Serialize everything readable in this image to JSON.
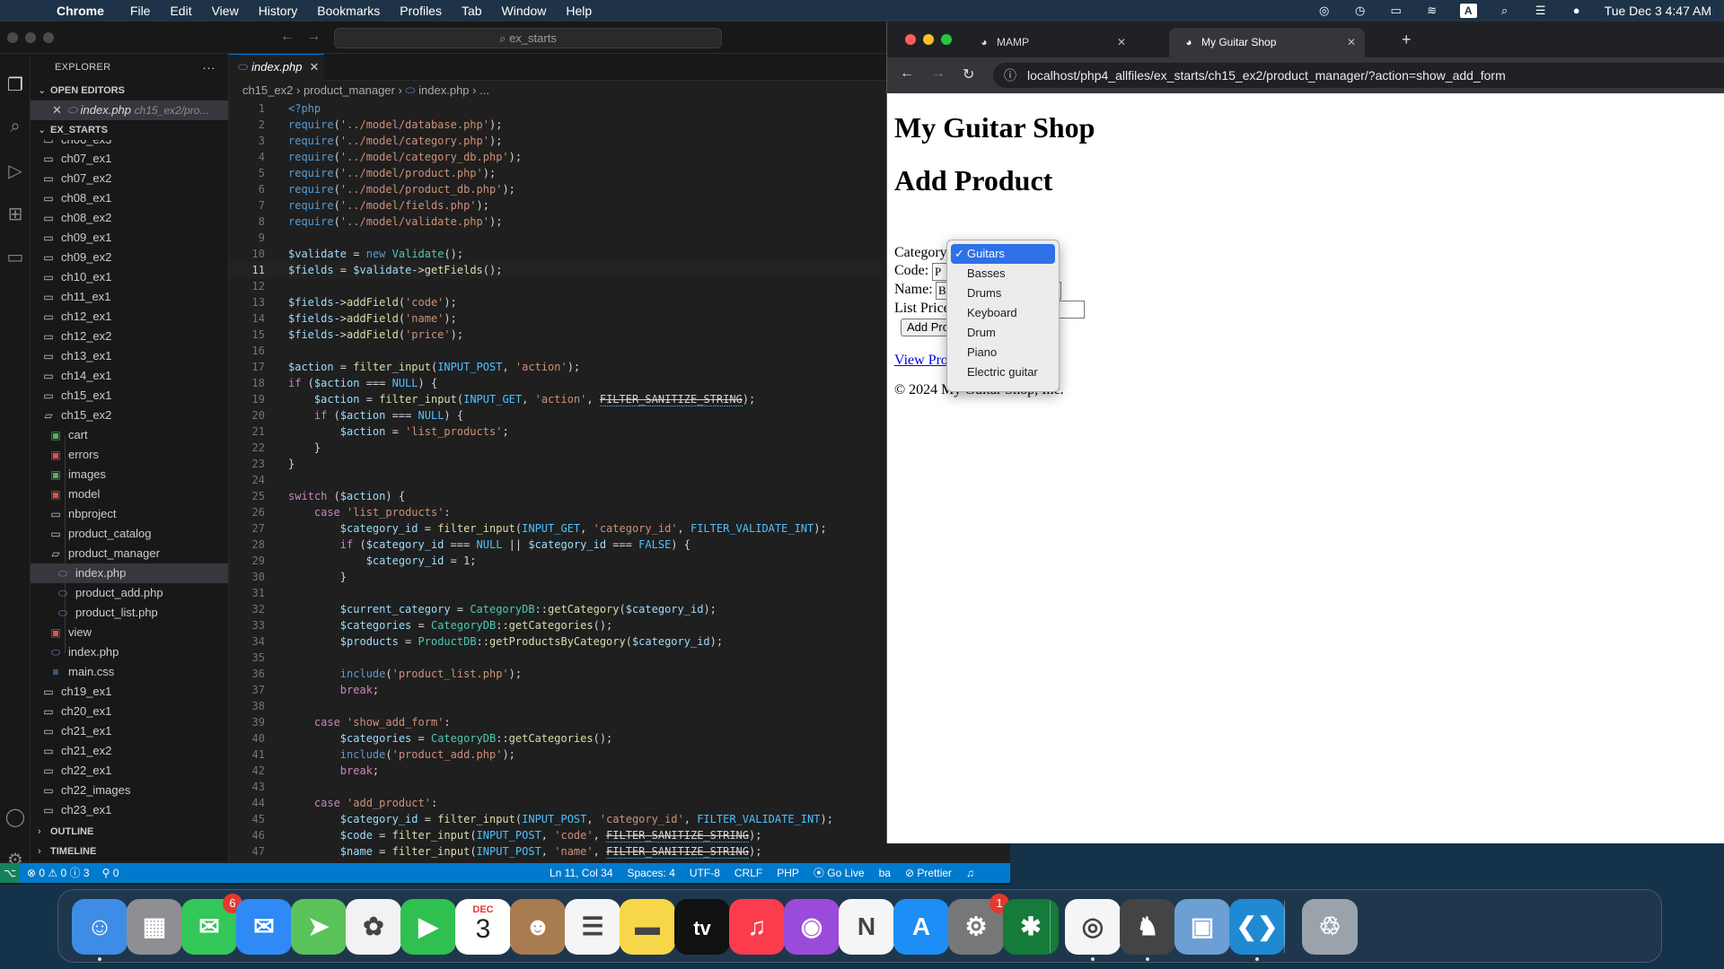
{
  "menubar": {
    "items": [
      "Chrome",
      "File",
      "Edit",
      "View",
      "History",
      "Bookmarks",
      "Profiles",
      "Tab",
      "Window",
      "Help"
    ],
    "input_indicator": "A",
    "datetime": "Tue Dec 3  4:47 AM"
  },
  "vscode": {
    "search_text": "ex_starts",
    "explorer_title": "EXPLORER",
    "open_editors_label": "OPEN EDITORS",
    "open_editor_file": "index.php",
    "open_editor_path": "ch15_ex2/pro...",
    "workspace_label": "EX_STARTS",
    "tree": [
      {
        "name": "ch06_ex3",
        "type": "folder"
      },
      {
        "name": "ch07_ex1",
        "type": "folder"
      },
      {
        "name": "ch07_ex2",
        "type": "folder"
      },
      {
        "name": "ch08_ex1",
        "type": "folder"
      },
      {
        "name": "ch08_ex2",
        "type": "folder"
      },
      {
        "name": "ch09_ex1",
        "type": "folder"
      },
      {
        "name": "ch09_ex2",
        "type": "folder"
      },
      {
        "name": "ch10_ex1",
        "type": "folder"
      },
      {
        "name": "ch11_ex1",
        "type": "folder"
      },
      {
        "name": "ch12_ex1",
        "type": "folder"
      },
      {
        "name": "ch12_ex2",
        "type": "folder"
      },
      {
        "name": "ch13_ex1",
        "type": "folder"
      },
      {
        "name": "ch14_ex1",
        "type": "folder"
      },
      {
        "name": "ch15_ex1",
        "type": "folder"
      },
      {
        "name": "ch15_ex2",
        "type": "folder-open"
      },
      {
        "name": "cart",
        "type": "folder-green",
        "depth": 1
      },
      {
        "name": "errors",
        "type": "folder-red",
        "depth": 1
      },
      {
        "name": "images",
        "type": "folder-green",
        "depth": 1
      },
      {
        "name": "model",
        "type": "folder-red",
        "depth": 1
      },
      {
        "name": "nbproject",
        "type": "folder",
        "depth": 1
      },
      {
        "name": "product_catalog",
        "type": "folder",
        "depth": 1
      },
      {
        "name": "product_manager",
        "type": "folder-open",
        "depth": 1
      },
      {
        "name": "index.php",
        "type": "php",
        "depth": 2,
        "selected": true
      },
      {
        "name": "product_add.php",
        "type": "php",
        "depth": 2
      },
      {
        "name": "product_list.php",
        "type": "php",
        "depth": 2
      },
      {
        "name": "view",
        "type": "folder-red",
        "depth": 1
      },
      {
        "name": "index.php",
        "type": "php",
        "depth": 1
      },
      {
        "name": "main.css",
        "type": "css",
        "depth": 1
      },
      {
        "name": "ch19_ex1",
        "type": "folder"
      },
      {
        "name": "ch20_ex1",
        "type": "folder"
      },
      {
        "name": "ch21_ex1",
        "type": "folder"
      },
      {
        "name": "ch21_ex2",
        "type": "folder"
      },
      {
        "name": "ch22_ex1",
        "type": "folder"
      },
      {
        "name": "ch22_images",
        "type": "folder"
      },
      {
        "name": "ch23_ex1",
        "type": "folder"
      }
    ],
    "outline_label": "OUTLINE",
    "timeline_label": "TIMELINE",
    "tab_label": "index.php",
    "breadcrumb": [
      "ch15_ex2",
      "product_manager",
      "index.php",
      "..."
    ],
    "code_lines": [
      "<?php",
      "require('../model/database.php');",
      "require('../model/category.php');",
      "require('../model/category_db.php');",
      "require('../model/product.php');",
      "require('../model/product_db.php');",
      "require('../model/fields.php');",
      "require('../model/validate.php');",
      "",
      "$validate = new Validate();",
      "$fields = $validate->getFields();",
      "",
      "$fields->addField('code');",
      "$fields->addField('name');",
      "$fields->addField('price');",
      "",
      "$action = filter_input(INPUT_POST, 'action');",
      "if ($action === NULL) {",
      "    $action = filter_input(INPUT_GET, 'action', FILTER_SANITIZE_STRING);",
      "    if ($action === NULL) {",
      "        $action = 'list_products';",
      "    }",
      "}",
      "",
      "switch ($action) {",
      "    case 'list_products':",
      "        $category_id = filter_input(INPUT_GET, 'category_id', FILTER_VALIDATE_INT);",
      "        if ($category_id === NULL || $category_id === FALSE) {",
      "            $category_id = 1;",
      "        }",
      "",
      "        $current_category = CategoryDB::getCategory($category_id);",
      "        $categories = CategoryDB::getCategories();",
      "        $products = ProductDB::getProductsByCategory($category_id);",
      "",
      "        include('product_list.php');",
      "        break;",
      "",
      "    case 'show_add_form':",
      "        $categories = CategoryDB::getCategories();",
      "        include('product_add.php');",
      "        break;",
      "",
      "    case 'add_product':",
      "        $category_id = filter_input(INPUT_POST, 'category_id', FILTER_VALIDATE_INT);",
      "        $code = filter_input(INPUT_POST, 'code', FILTER_SANITIZE_STRING);",
      "        $name = filter_input(INPUT_POST, 'name', FILTER_SANITIZE_STRING);"
    ],
    "status": {
      "errors": "0",
      "warnings": "0",
      "info": "3",
      "ports": "0",
      "position": "Ln 11, Col 34",
      "spaces": "Spaces: 4",
      "encoding": "UTF-8",
      "eol": "CRLF",
      "language": "PHP",
      "golive": "Go Live",
      "ba": "ba",
      "prettier": "Prettier"
    }
  },
  "chrome": {
    "tabs": [
      {
        "title": "MAMP",
        "active": false
      },
      {
        "title": "My Guitar Shop",
        "active": true
      }
    ],
    "url": "localhost/php4_allfiles/ex_starts/ch15_ex2/product_manager/?action=show_add_form",
    "page": {
      "h1": "My Guitar Shop",
      "h2": "Add Product",
      "category_label": "Category:",
      "code_label": "Code:",
      "code_value": "P",
      "name_label": "Name:",
      "name_value": "B",
      "price_label": "List Price:",
      "add_button": "Add Product",
      "view_link": "View Product List",
      "footer": "© 2024 My Guitar Shop, Inc.",
      "category_options": [
        "Guitars",
        "Basses",
        "Drums",
        "Keyboard",
        "Drum",
        "Piano",
        "Electric guitar"
      ],
      "selected_option": "Guitars"
    }
  },
  "dock": {
    "apps": [
      {
        "name": "Finder",
        "color": "#3d8de6"
      },
      {
        "name": "Launchpad",
        "color": "#8e8e93"
      },
      {
        "name": "Messages",
        "color": "#34c759",
        "badge": "6"
      },
      {
        "name": "Mail",
        "color": "#2f8af5"
      },
      {
        "name": "Maps",
        "color": "#5ac35a"
      },
      {
        "name": "Photos",
        "color": "#f2f2f2"
      },
      {
        "name": "FaceTime",
        "color": "#30c04f"
      },
      {
        "name": "Calendar",
        "color": "#ffffff",
        "month": "DEC",
        "day": "3"
      },
      {
        "name": "Contacts",
        "color": "#a97b50"
      },
      {
        "name": "Reminders",
        "color": "#f5f5f5"
      },
      {
        "name": "Notes",
        "color": "#f7d64a"
      },
      {
        "name": "TV",
        "color": "#111111",
        "label": "tv"
      },
      {
        "name": "Music",
        "color": "#fa3c4c"
      },
      {
        "name": "Podcasts",
        "color": "#9b4bd9"
      },
      {
        "name": "News",
        "color": "#f5f5f5"
      },
      {
        "name": "App Store",
        "color": "#1c8ef5"
      },
      {
        "name": "System Settings",
        "color": "#777777",
        "badge": "1"
      },
      {
        "name": "Hugo",
        "color": "#157a3a"
      },
      {
        "name": "Chrome",
        "color": "#f5f5f5"
      },
      {
        "name": "MAMP",
        "color": "#444444"
      },
      {
        "name": "Preview",
        "color": "#6c9fd4"
      },
      {
        "name": "VS Code",
        "color": "#1f8ad2"
      },
      {
        "name": "Trash",
        "color": "#9aa3ab"
      }
    ]
  }
}
